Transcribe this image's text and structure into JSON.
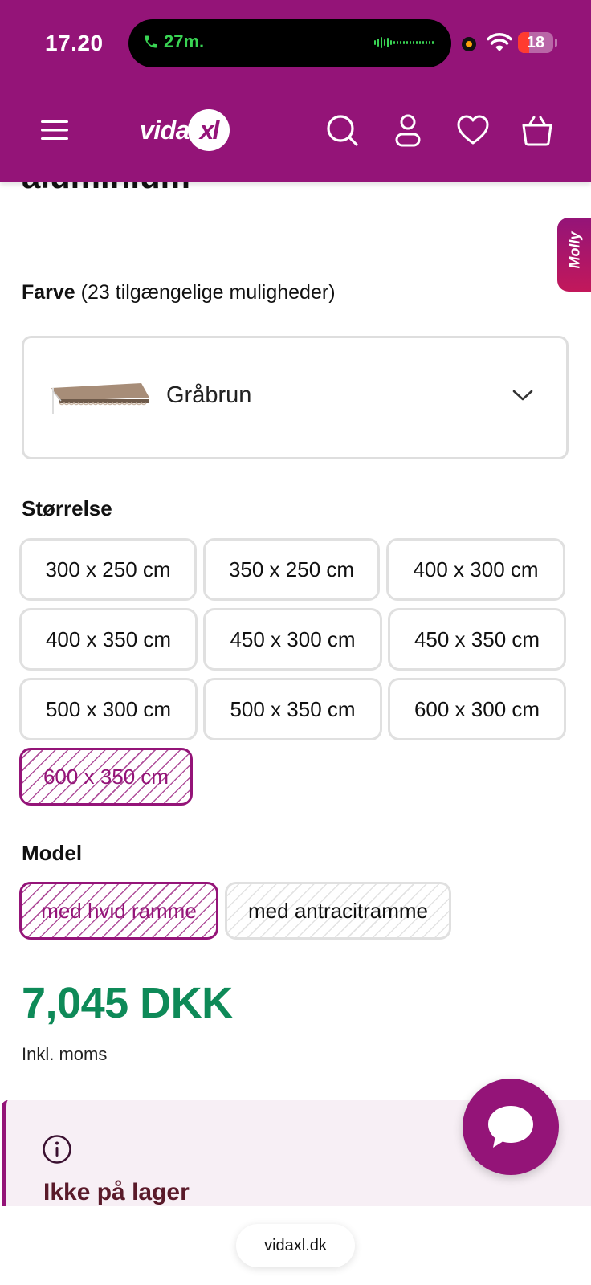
{
  "status_bar": {
    "time": "17.20",
    "call_duration": "27m.",
    "battery": "18"
  },
  "header": {
    "logo_word": "vida",
    "logo_badge": "xl",
    "icons": [
      "menu-icon",
      "search-icon",
      "account-icon",
      "heart-icon",
      "basket-icon"
    ]
  },
  "product": {
    "title_fragment": "aluminium"
  },
  "molly_tab": "Molly",
  "color": {
    "label": "Farve",
    "count_text": "(23 tilgængelige muligheder)",
    "selected": "Gråbrun"
  },
  "size": {
    "label": "Størrelse",
    "options": [
      "300 x 250 cm",
      "350 x 250 cm",
      "400 x 300 cm",
      "400 x 350 cm",
      "450 x 300 cm",
      "450 x 350 cm",
      "500 x 300 cm",
      "500 x 350 cm",
      "600 x 300 cm",
      "600 x 350 cm"
    ],
    "selected": "600 x 350 cm"
  },
  "model": {
    "label": "Model",
    "options": [
      "med hvid ramme",
      "med antracitramme"
    ],
    "selected": "med hvid ramme"
  },
  "price": {
    "amount": "7,045 DKK",
    "vat_note": "Inkl. moms"
  },
  "stock": {
    "status": "Ikke på lager"
  },
  "browser": {
    "url": "vidaxl.dk"
  },
  "colors": {
    "brand": "#941478",
    "price": "#0e8a58",
    "stock_bg": "#f7eff5"
  }
}
